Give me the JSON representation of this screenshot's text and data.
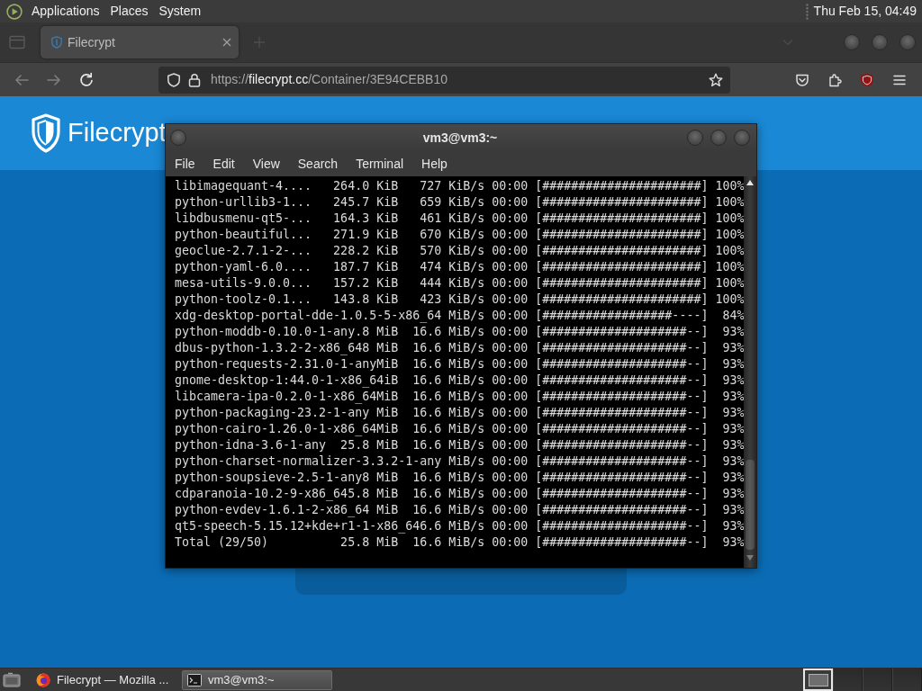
{
  "top_panel": {
    "menus": [
      "Applications",
      "Places",
      "System"
    ],
    "clock": "Thu Feb 15, 04:49"
  },
  "browser": {
    "tabs": [
      {
        "title": "Filecrypt",
        "selected": true
      }
    ],
    "nav_buttons": [
      {
        "kind": "back",
        "disabled": true
      },
      {
        "kind": "forward",
        "disabled": true
      },
      {
        "kind": "reload",
        "disabled": false
      }
    ],
    "url": {
      "scheme": "https://",
      "domain": "filecrypt.cc",
      "path": "/Container/3E94CEBB10"
    },
    "page": {
      "logo_text": "Filecrypt"
    }
  },
  "terminal": {
    "title": "vm3@vm3:~",
    "menu": [
      "File",
      "Edit",
      "View",
      "Search",
      "Terminal",
      "Help"
    ],
    "lines": [
      "libimagequant-4....   264.0 KiB   727 KiB/s 00:00 [######################] 100%",
      "python-urllib3-1...   245.7 KiB   659 KiB/s 00:00 [######################] 100%",
      "libdbusmenu-qt5-...   164.3 KiB   461 KiB/s 00:00 [######################] 100%",
      "python-beautiful...   271.9 KiB   670 KiB/s 00:00 [######################] 100%",
      "geoclue-2.7.1-2-...   228.2 KiB   570 KiB/s 00:00 [######################] 100%",
      "python-yaml-6.0....   187.7 KiB   474 KiB/s 00:00 [######################] 100%",
      "mesa-utils-9.0.0...   157.2 KiB   444 KiB/s 00:00 [######################] 100%",
      "python-toolz-0.1...   143.8 KiB   423 KiB/s 00:00 [######################] 100%",
      "xdg-desktop-portal-dde-1.0.5-5-x86_64 MiB/s 00:00 [##################----]  84%",
      "python-moddb-0.10.0-1-any.8 MiB  16.6 MiB/s 00:00 [####################--]  93%",
      "dbus-python-1.3.2-2-x86_648 MiB  16.6 MiB/s 00:00 [####################--]  93%",
      "python-requests-2.31.0-1-anyMiB  16.6 MiB/s 00:00 [####################--]  93%",
      "gnome-desktop-1:44.0-1-x86_64iB  16.6 MiB/s 00:00 [####################--]  93%",
      "libcamera-ipa-0.2.0-1-x86_64MiB  16.6 MiB/s 00:00 [####################--]  93%",
      "python-packaging-23.2-1-any MiB  16.6 MiB/s 00:00 [####################--]  93%",
      "python-cairo-1.26.0-1-x86_64MiB  16.6 MiB/s 00:00 [####################--]  93%",
      "python-idna-3.6-1-any  25.8 MiB  16.6 MiB/s 00:00 [####################--]  93%",
      "python-charset-normalizer-3.3.2-1-any MiB/s 00:00 [####################--]  93%",
      "python-soupsieve-2.5-1-any8 MiB  16.6 MiB/s 00:00 [####################--]  93%",
      "cdparanoia-10.2-9-x86_645.8 MiB  16.6 MiB/s 00:00 [####################--]  93%",
      "python-evdev-1.6.1-2-x86_64 MiB  16.6 MiB/s 00:00 [####################--]  93%",
      "qt5-speech-5.15.12+kde+r1-1-x86_646.6 MiB/s 00:00 [####################--]  93%",
      "Total (29/50)          25.8 MiB  16.6 MiB/s 00:00 [####################--]  93%"
    ]
  },
  "taskbar": {
    "tasks": [
      {
        "kind": "browser",
        "label": "Filecrypt — Mozilla ...",
        "selected": false
      },
      {
        "kind": "terminal",
        "label": "vm3@vm3:~",
        "selected": true
      }
    ],
    "workspaces": [
      {
        "selected": true,
        "has_window": true
      },
      {
        "selected": false,
        "has_window": false
      },
      {
        "selected": false,
        "has_window": false
      },
      {
        "selected": false,
        "has_window": false
      }
    ]
  }
}
